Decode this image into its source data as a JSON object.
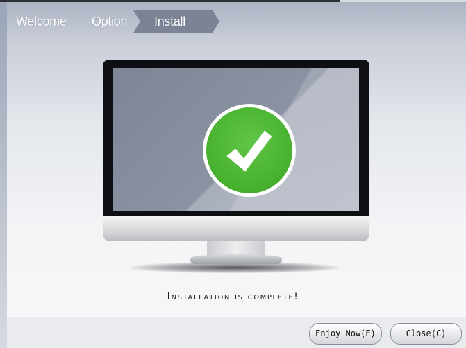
{
  "breadcrumb": {
    "steps": [
      {
        "label": "Welcome",
        "active": false
      },
      {
        "label": "Option",
        "active": false
      },
      {
        "label": "Install",
        "active": true
      }
    ]
  },
  "status": {
    "message": "Installation is complete!"
  },
  "footer": {
    "enjoy_button": "Enjoy Now(E)",
    "close_button": "Close(C)"
  },
  "icons": {
    "success": "checkmark-icon",
    "device": "monitor-illustration"
  },
  "colors": {
    "success_green": "#48b02f",
    "breadcrumb_active_bg": "#7c8394",
    "header_bg": "#aab2c2"
  }
}
